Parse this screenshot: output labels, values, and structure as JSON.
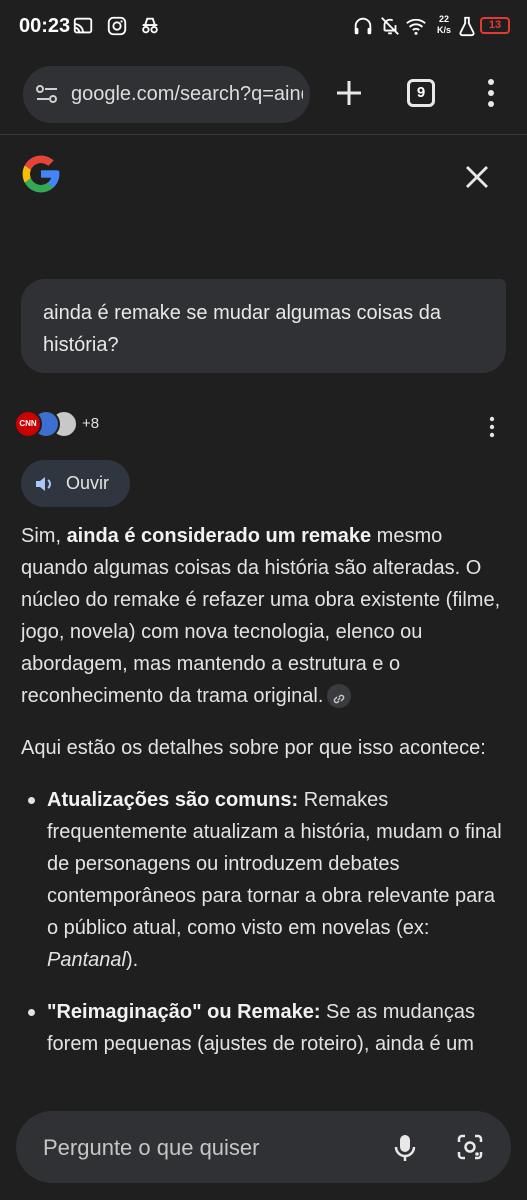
{
  "status_bar": {
    "time": "00:23",
    "net_speed_top": "22",
    "net_speed_bottom": "K/s",
    "battery": "13",
    "icons": [
      "cast-icon",
      "instagram-icon",
      "incognito-icon",
      "headphones-icon",
      "bell-off-icon",
      "wifi-icon",
      "lab-icon",
      "battery-icon"
    ]
  },
  "browser": {
    "url": "google.com/search?q=ainda",
    "tab_count": "9"
  },
  "query": "ainda é remake se mudar algumas coisas da história?",
  "sources": {
    "first_label": "CNN",
    "more": "+8"
  },
  "listen_button": "Ouvir",
  "answer": {
    "p1_pre": "Sim, ",
    "p1_bold": "ainda é considerado um remake",
    "p1_post": " mesmo quando algumas coisas da história são alteradas. O núcleo do remake é refazer uma obra existente (filme, jogo, novela) com nova tecnologia, elenco ou abordagem, mas mantendo a estrutura e o reconhecimento da trama original.",
    "p2": "Aqui estão os detalhes sobre por que isso acontece:",
    "b1_bold": "Atualizações são comuns:",
    "b1_text": " Remakes frequentemente atualizam a história, mudam o final de personagens ou introduzem debates contemporâneos para tornar a obra relevante para o público atual, como visto em novelas (ex: ",
    "b1_italic": "Pantanal",
    "b1_end": ").",
    "b2_bold": "\"Reimaginação\" ou Remake:",
    "b2_text": " Se as mudanças forem pequenas (ajustes de roteiro), ainda é um"
  },
  "ask_bar": {
    "placeholder": "Pergunte o que quiser"
  },
  "colors": {
    "background": "#1f1f1f",
    "bubble": "#303134",
    "battery_low": "#e53935"
  }
}
